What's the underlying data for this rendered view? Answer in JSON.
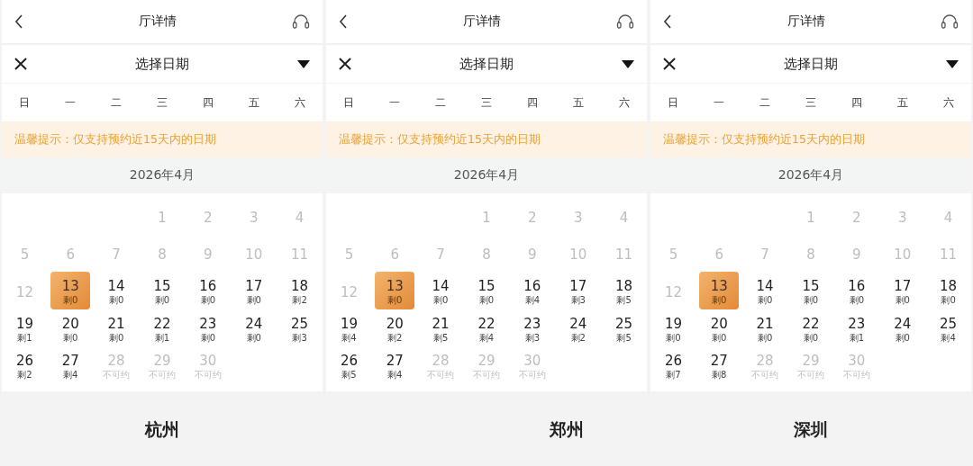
{
  "panels": [
    {
      "header": {
        "title": "厅详情"
      },
      "picker": {
        "title": "选择日期"
      },
      "weekdays": [
        "日",
        "一",
        "二",
        "三",
        "四",
        "五",
        "六"
      ],
      "notice": "温馨提示：仅支持预约近15天内的日期",
      "month": "2026年4月",
      "caption": "杭州",
      "days": [
        {
          "kind": "blank"
        },
        {
          "kind": "blank"
        },
        {
          "kind": "blank"
        },
        {
          "kind": "day",
          "day": "1",
          "disabled": true,
          "selected": false
        },
        {
          "kind": "day",
          "day": "2",
          "disabled": true,
          "selected": false
        },
        {
          "kind": "day",
          "day": "3",
          "disabled": true,
          "selected": false
        },
        {
          "kind": "day",
          "day": "4",
          "disabled": true,
          "selected": false
        },
        {
          "kind": "day",
          "day": "5",
          "disabled": true,
          "selected": false
        },
        {
          "kind": "day",
          "day": "6",
          "disabled": true,
          "selected": false
        },
        {
          "kind": "day",
          "day": "7",
          "disabled": true,
          "selected": false
        },
        {
          "kind": "day",
          "day": "8",
          "disabled": true,
          "selected": false
        },
        {
          "kind": "day",
          "day": "9",
          "disabled": true,
          "selected": false
        },
        {
          "kind": "day",
          "day": "10",
          "disabled": true,
          "selected": false
        },
        {
          "kind": "day",
          "day": "11",
          "disabled": true,
          "selected": false
        },
        {
          "kind": "day",
          "day": "12",
          "disabled": true,
          "selected": false
        },
        {
          "kind": "day",
          "day": "13",
          "note": "剩0",
          "disabled": false,
          "selected": true
        },
        {
          "kind": "day",
          "day": "14",
          "note": "剩0",
          "disabled": false,
          "selected": false
        },
        {
          "kind": "day",
          "day": "15",
          "note": "剩0",
          "disabled": false,
          "selected": false
        },
        {
          "kind": "day",
          "day": "16",
          "note": "剩0",
          "disabled": false,
          "selected": false
        },
        {
          "kind": "day",
          "day": "17",
          "note": "剩0",
          "disabled": false,
          "selected": false
        },
        {
          "kind": "day",
          "day": "18",
          "note": "剩2",
          "disabled": false,
          "selected": false
        },
        {
          "kind": "day",
          "day": "19",
          "note": "剩1",
          "disabled": false,
          "selected": false
        },
        {
          "kind": "day",
          "day": "20",
          "note": "剩0",
          "disabled": false,
          "selected": false
        },
        {
          "kind": "day",
          "day": "21",
          "note": "剩0",
          "disabled": false,
          "selected": false
        },
        {
          "kind": "day",
          "day": "22",
          "note": "剩1",
          "disabled": false,
          "selected": false
        },
        {
          "kind": "day",
          "day": "23",
          "note": "剩0",
          "disabled": false,
          "selected": false
        },
        {
          "kind": "day",
          "day": "24",
          "note": "剩0",
          "disabled": false,
          "selected": false
        },
        {
          "kind": "day",
          "day": "25",
          "note": "剩3",
          "disabled": false,
          "selected": false
        },
        {
          "kind": "day",
          "day": "26",
          "note": "剩2",
          "disabled": false,
          "selected": false
        },
        {
          "kind": "day",
          "day": "27",
          "note": "剩4",
          "disabled": false,
          "selected": false
        },
        {
          "kind": "day",
          "day": "28",
          "note": "不可约",
          "disabled": true,
          "selected": false
        },
        {
          "kind": "day",
          "day": "29",
          "note": "不可约",
          "disabled": true,
          "selected": false
        },
        {
          "kind": "day",
          "day": "30",
          "note": "不可约",
          "disabled": true,
          "selected": false
        }
      ]
    },
    {
      "header": {
        "title": "厅详情"
      },
      "picker": {
        "title": "选择日期"
      },
      "weekdays": [
        "日",
        "一",
        "二",
        "三",
        "四",
        "五",
        "六"
      ],
      "notice": "温馨提示：仅支持预约近15天内的日期",
      "month": "2026年4月",
      "caption": "郑州",
      "days": [
        {
          "kind": "blank"
        },
        {
          "kind": "blank"
        },
        {
          "kind": "blank"
        },
        {
          "kind": "day",
          "day": "1",
          "disabled": true,
          "selected": false
        },
        {
          "kind": "day",
          "day": "2",
          "disabled": true,
          "selected": false
        },
        {
          "kind": "day",
          "day": "3",
          "disabled": true,
          "selected": false
        },
        {
          "kind": "day",
          "day": "4",
          "disabled": true,
          "selected": false
        },
        {
          "kind": "day",
          "day": "5",
          "disabled": true,
          "selected": false
        },
        {
          "kind": "day",
          "day": "6",
          "disabled": true,
          "selected": false
        },
        {
          "kind": "day",
          "day": "7",
          "disabled": true,
          "selected": false
        },
        {
          "kind": "day",
          "day": "8",
          "disabled": true,
          "selected": false
        },
        {
          "kind": "day",
          "day": "9",
          "disabled": true,
          "selected": false
        },
        {
          "kind": "day",
          "day": "10",
          "disabled": true,
          "selected": false
        },
        {
          "kind": "day",
          "day": "11",
          "disabled": true,
          "selected": false
        },
        {
          "kind": "day",
          "day": "12",
          "disabled": true,
          "selected": false
        },
        {
          "kind": "day",
          "day": "13",
          "note": "剩0",
          "disabled": false,
          "selected": true
        },
        {
          "kind": "day",
          "day": "14",
          "note": "剩0",
          "disabled": false,
          "selected": false
        },
        {
          "kind": "day",
          "day": "15",
          "note": "剩0",
          "disabled": false,
          "selected": false
        },
        {
          "kind": "day",
          "day": "16",
          "note": "剩4",
          "disabled": false,
          "selected": false
        },
        {
          "kind": "day",
          "day": "17",
          "note": "剩3",
          "disabled": false,
          "selected": false
        },
        {
          "kind": "day",
          "day": "18",
          "note": "剩5",
          "disabled": false,
          "selected": false
        },
        {
          "kind": "day",
          "day": "19",
          "note": "剩4",
          "disabled": false,
          "selected": false
        },
        {
          "kind": "day",
          "day": "20",
          "note": "剩2",
          "disabled": false,
          "selected": false
        },
        {
          "kind": "day",
          "day": "21",
          "note": "剩5",
          "disabled": false,
          "selected": false
        },
        {
          "kind": "day",
          "day": "22",
          "note": "剩4",
          "disabled": false,
          "selected": false
        },
        {
          "kind": "day",
          "day": "23",
          "note": "剩3",
          "disabled": false,
          "selected": false
        },
        {
          "kind": "day",
          "day": "24",
          "note": "剩2",
          "disabled": false,
          "selected": false
        },
        {
          "kind": "day",
          "day": "25",
          "note": "剩5",
          "disabled": false,
          "selected": false
        },
        {
          "kind": "day",
          "day": "26",
          "note": "剩5",
          "disabled": false,
          "selected": false
        },
        {
          "kind": "day",
          "day": "27",
          "note": "剩4",
          "disabled": false,
          "selected": false
        },
        {
          "kind": "day",
          "day": "28",
          "note": "不可约",
          "disabled": true,
          "selected": false
        },
        {
          "kind": "day",
          "day": "29",
          "note": "不可约",
          "disabled": true,
          "selected": false
        },
        {
          "kind": "day",
          "day": "30",
          "note": "不可约",
          "disabled": true,
          "selected": false
        }
      ]
    },
    {
      "header": {
        "title": "厅详情"
      },
      "picker": {
        "title": "选择日期"
      },
      "weekdays": [
        "日",
        "一",
        "二",
        "三",
        "四",
        "五",
        "六"
      ],
      "notice": "温馨提示：仅支持预约近15天内的日期",
      "month": "2026年4月",
      "caption": "深圳",
      "days": [
        {
          "kind": "blank"
        },
        {
          "kind": "blank"
        },
        {
          "kind": "blank"
        },
        {
          "kind": "day",
          "day": "1",
          "disabled": true,
          "selected": false
        },
        {
          "kind": "day",
          "day": "2",
          "disabled": true,
          "selected": false
        },
        {
          "kind": "day",
          "day": "3",
          "disabled": true,
          "selected": false
        },
        {
          "kind": "day",
          "day": "4",
          "disabled": true,
          "selected": false
        },
        {
          "kind": "day",
          "day": "5",
          "disabled": true,
          "selected": false
        },
        {
          "kind": "day",
          "day": "6",
          "disabled": true,
          "selected": false
        },
        {
          "kind": "day",
          "day": "7",
          "disabled": true,
          "selected": false
        },
        {
          "kind": "day",
          "day": "8",
          "disabled": true,
          "selected": false
        },
        {
          "kind": "day",
          "day": "9",
          "disabled": true,
          "selected": false
        },
        {
          "kind": "day",
          "day": "10",
          "disabled": true,
          "selected": false
        },
        {
          "kind": "day",
          "day": "11",
          "disabled": true,
          "selected": false
        },
        {
          "kind": "day",
          "day": "12",
          "disabled": true,
          "selected": false
        },
        {
          "kind": "day",
          "day": "13",
          "note": "剩0",
          "disabled": false,
          "selected": true
        },
        {
          "kind": "day",
          "day": "14",
          "note": "剩0",
          "disabled": false,
          "selected": false
        },
        {
          "kind": "day",
          "day": "15",
          "note": "剩0",
          "disabled": false,
          "selected": false
        },
        {
          "kind": "day",
          "day": "16",
          "note": "剩0",
          "disabled": false,
          "selected": false
        },
        {
          "kind": "day",
          "day": "17",
          "note": "剩0",
          "disabled": false,
          "selected": false
        },
        {
          "kind": "day",
          "day": "18",
          "note": "剩0",
          "disabled": false,
          "selected": false
        },
        {
          "kind": "day",
          "day": "19",
          "note": "剩0",
          "disabled": false,
          "selected": false
        },
        {
          "kind": "day",
          "day": "20",
          "note": "剩0",
          "disabled": false,
          "selected": false
        },
        {
          "kind": "day",
          "day": "21",
          "note": "剩0",
          "disabled": false,
          "selected": false
        },
        {
          "kind": "day",
          "day": "22",
          "note": "剩0",
          "disabled": false,
          "selected": false
        },
        {
          "kind": "day",
          "day": "23",
          "note": "剩1",
          "disabled": false,
          "selected": false
        },
        {
          "kind": "day",
          "day": "24",
          "note": "剩0",
          "disabled": false,
          "selected": false
        },
        {
          "kind": "day",
          "day": "25",
          "note": "剩4",
          "disabled": false,
          "selected": false
        },
        {
          "kind": "day",
          "day": "26",
          "note": "剩7",
          "disabled": false,
          "selected": false
        },
        {
          "kind": "day",
          "day": "27",
          "note": "剩8",
          "disabled": false,
          "selected": false
        },
        {
          "kind": "day",
          "day": "28",
          "note": "不可约",
          "disabled": true,
          "selected": false
        },
        {
          "kind": "day",
          "day": "29",
          "note": "不可约",
          "disabled": true,
          "selected": false
        },
        {
          "kind": "day",
          "day": "30",
          "note": "不可约",
          "disabled": true,
          "selected": false
        }
      ]
    }
  ]
}
